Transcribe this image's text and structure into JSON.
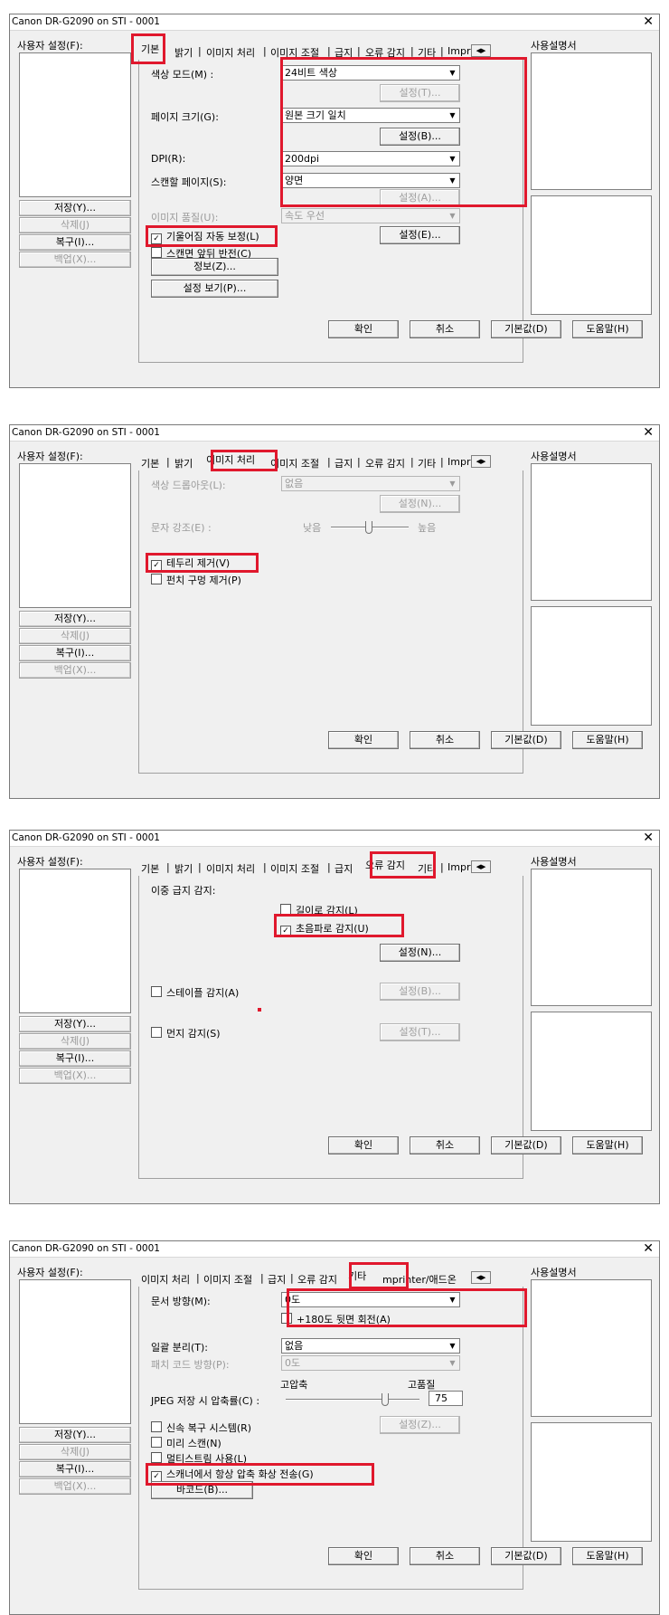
{
  "window_title": "Canon DR-G2090 on STI - 0001",
  "close_glyph": "✕",
  "left": {
    "user_settings_label": "사용자 설정(F):",
    "save": "저장(Y)...",
    "delete": "삭제(J)",
    "restore": "복구(I)...",
    "backup": "백업(X)..."
  },
  "right": {
    "manual_label": "사용설명서"
  },
  "bottom": {
    "ok": "확인",
    "cancel": "취소",
    "default": "기본값(D)",
    "help": "도움말(H)"
  },
  "tabs": {
    "basic": "기본",
    "brightness": "밝기",
    "image_processing": "이미지 처리",
    "image_adjust": "이미지 조절",
    "feeding": "급지",
    "error_detect": "오류 감지",
    "other": "기타",
    "imprinter_short": "Impr",
    "imprinter_long": "mprinter/애드온",
    "scroll_left": "◀",
    "scroll_right": "▶"
  },
  "panel1": {
    "color_mode_label": "색상 모드(M) :",
    "color_mode_value": "24비트 색상",
    "settings_t": "설정(T)...",
    "page_size_label": "페이지 크기(G):",
    "page_size_value": "원본 크기 일치",
    "settings_b": "설정(B)...",
    "dpi_label": "DPI(R):",
    "dpi_value": "200dpi",
    "scan_side_label": "스캔할 페이지(S):",
    "scan_side_value": "양면",
    "settings_a": "설정(A)...",
    "image_quality_label": "이미지 품질(U):",
    "image_quality_value": "속도 우선",
    "deskew_label": "기울어짐 자동 보정(L)",
    "settings_e": "설정(E)...",
    "flip_label": "스캔면 앞뒤 반전(C)",
    "info_btn": "정보(Z)...",
    "view_settings_btn": "설정 보기(P)..."
  },
  "panel2": {
    "dropout_label": "색상 드롭아웃(L):",
    "dropout_value": "없음",
    "settings_n": "설정(N)...",
    "emphasis_label": "문자 강조(E) :",
    "low": "낮음",
    "high": "높음",
    "border_removal_label": "테두리 제거(V)",
    "punch_hole_label": "펀치 구멍 제거(P)"
  },
  "panel3": {
    "double_feed_label": "이중 급지 감지:",
    "by_length_label": "길이로 감지(L)",
    "by_ultrasonic_label": "초음파로 감지(U)",
    "settings_n": "설정(N)...",
    "staple_label": "스테이플 감지(A)",
    "settings_b": "설정(B)...",
    "dust_label": "먼지 감지(S)",
    "settings_t": "설정(T)..."
  },
  "panel4": {
    "orientation_label": "문서 방향(M):",
    "orientation_value": "0도",
    "rotate180_label": "+180도 뒷면 회전(A)",
    "batch_sep_label": "일괄 분리(T):",
    "batch_sep_value": "없음",
    "patch_code_label": "패치 코드 방향(P):",
    "patch_code_value": "0도",
    "high_compression": "고압축",
    "high_quality": "고품질",
    "jpeg_label": "JPEG 저장 시 압축률(C) :",
    "jpeg_value": "75",
    "settings_z": "설정(Z)...",
    "quick_recovery_label": "신속 복구 시스템(R)",
    "prescan_label": "미리 스캔(N)",
    "multistream_label": "멀티스트림 사용(L)",
    "compressed_transfer_label": "스캐너에서 항상 압축 화상 전송(G)",
    "barcode_btn": "바코드(B)..."
  }
}
